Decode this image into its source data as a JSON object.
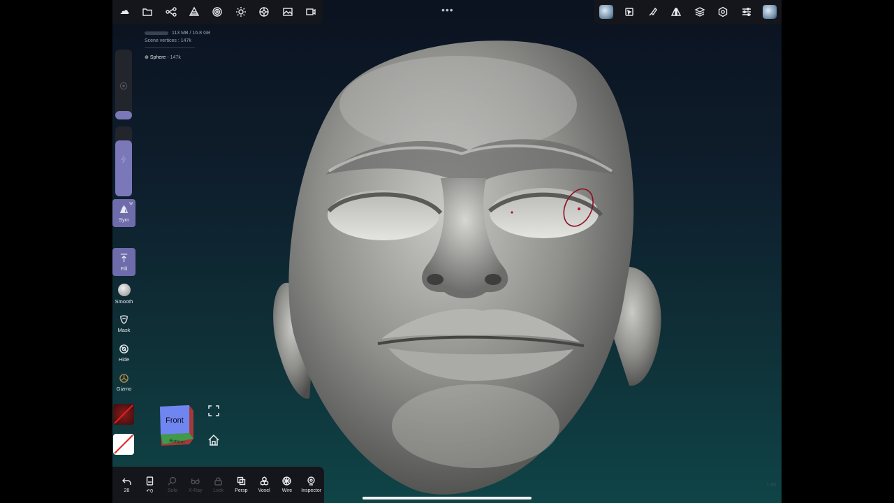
{
  "top_left_toolbar": {
    "icons": [
      "cloud-icon",
      "folder-icon",
      "scene-graph-icon",
      "topology-icon",
      "material-icon",
      "light-icon",
      "postprocess-icon",
      "image-icon",
      "video-icon"
    ]
  },
  "top_right_toolbar": {
    "icons": [
      "thumbnail-icon",
      "select-icon",
      "brush-icon",
      "symmetry-icon",
      "layers-icon",
      "settings-icon",
      "sliders-icon",
      "thumbnail-icon"
    ]
  },
  "stats": {
    "memory": "113 MB / 16.8 GB",
    "scene_vertices": "Scene vertices : 147k",
    "mesh_name": "Sphere",
    "mesh_vertices": "- 147k"
  },
  "left_tools": {
    "sym_label": "Sym",
    "sym_shortcut": "W",
    "fill_label": "Fill",
    "smooth_label": "Smooth",
    "mask_label": "Mask",
    "hide_label": "Hide",
    "gizmo_label": "Gizmo"
  },
  "view_cube": {
    "front_label": "Front",
    "bottom_label": "Bottom"
  },
  "bottom_bar": {
    "undo_count": "28",
    "history_count": "↶0",
    "solo_label": "Solo",
    "xray_label": "X-Ray",
    "lock_label": "Lock",
    "persp_label": "Persp",
    "voxel_label": "Voxel",
    "wire_label": "Wire",
    "inspector_label": "Inspector"
  },
  "version": "1.60",
  "colors": {
    "accent": "#6e6cab",
    "toolbar_bg": "#15161b",
    "cursor_ring": "#8b1020",
    "sculpt_base": "#9a9a97"
  }
}
